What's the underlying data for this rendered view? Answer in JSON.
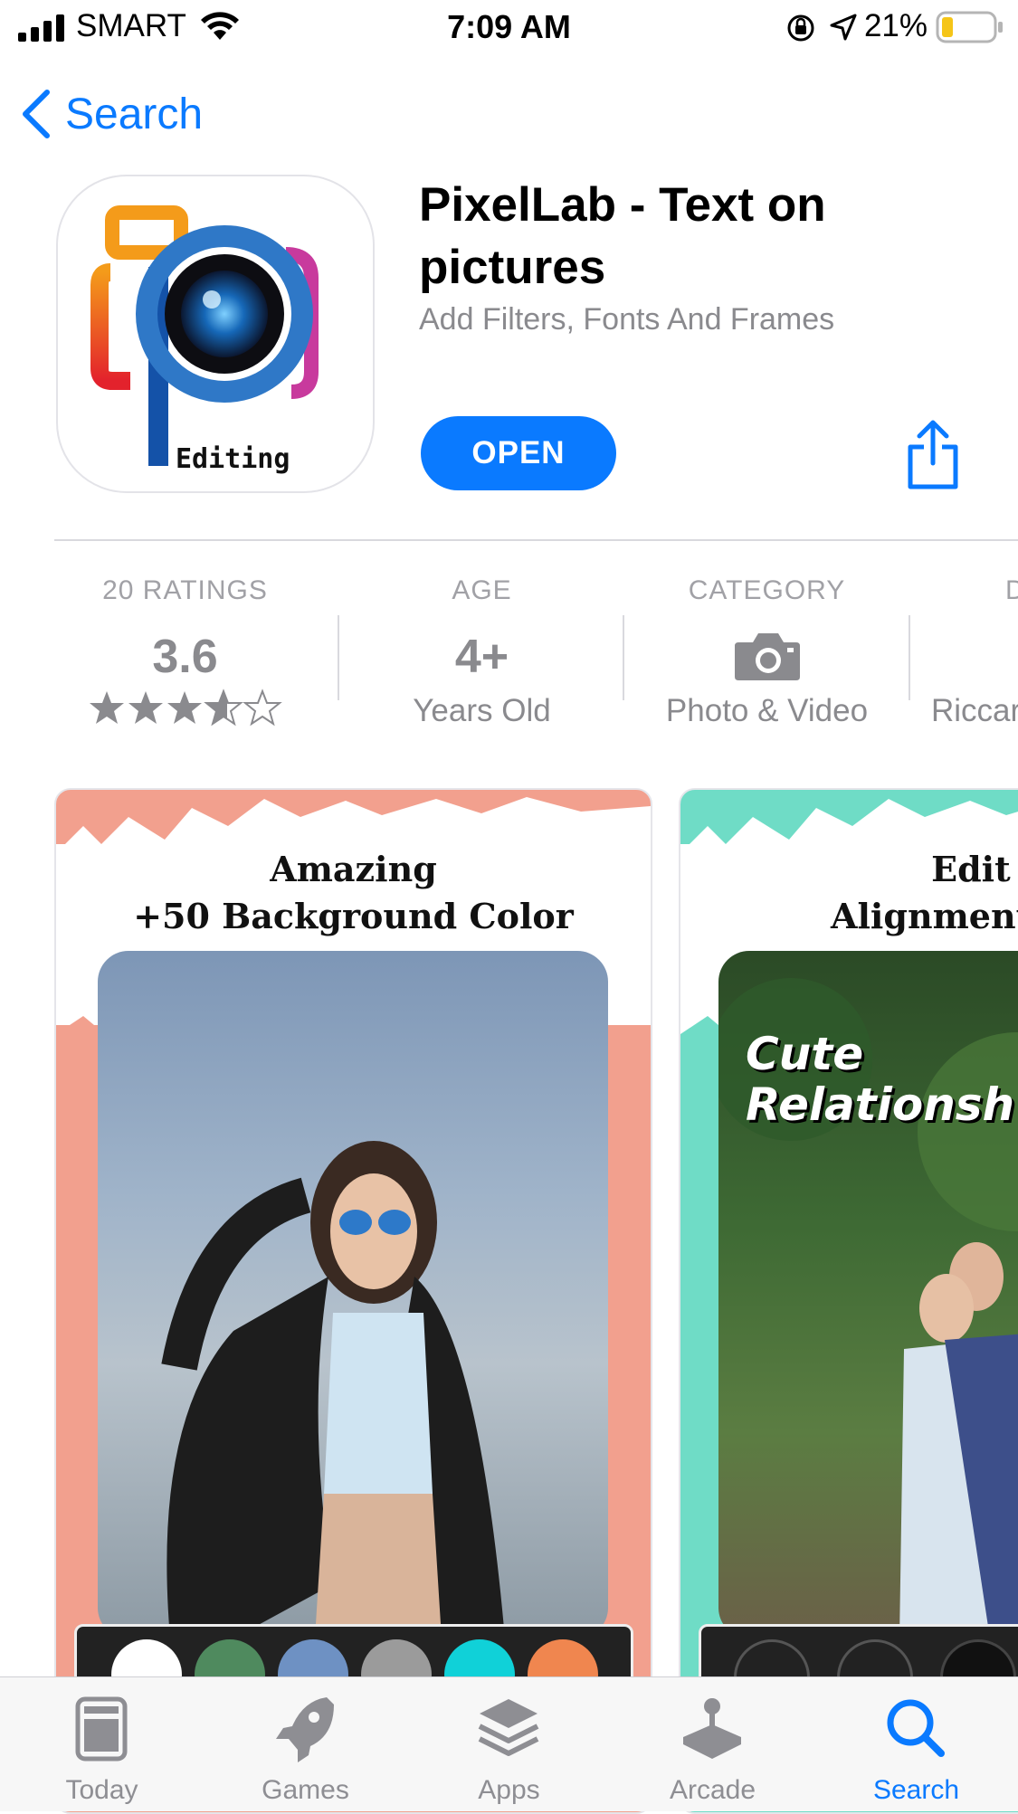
{
  "status_bar": {
    "carrier": "SMART",
    "time": "7:09 AM",
    "battery": "21%"
  },
  "nav": {
    "back_label": "Search"
  },
  "app": {
    "title": "PixelLab - Text on pictures",
    "subtitle": "Add Filters, Fonts And Frames",
    "open_label": "OPEN",
    "icon_text": "Editing"
  },
  "info": {
    "ratings_caption": "20 RATINGS",
    "rating_value": "3.6",
    "rating_stars": 3.6,
    "age_caption": "AGE",
    "age_value": "4+",
    "age_sub": "Years Old",
    "category_caption": "CATEGORY",
    "category_sub": "Photo & Video",
    "developer_caption": "D",
    "developer_sub": "Riccar"
  },
  "screenshots": [
    {
      "caption_line1": "Amazing",
      "caption_line2": "+50  Background Color"
    },
    {
      "caption_line1": "Edit Te",
      "caption_line2": "Alignment a",
      "overlay_line1": "Cute",
      "overlay_line2": "Relationsh"
    }
  ],
  "tabs": [
    {
      "label": "Today"
    },
    {
      "label": "Games"
    },
    {
      "label": "Apps"
    },
    {
      "label": "Arcade"
    },
    {
      "label": "Search"
    }
  ],
  "colors": {
    "accent": "#0a7aff",
    "shot1_frame": "#f2a08e",
    "shot2_frame": "#6fdcc6"
  }
}
